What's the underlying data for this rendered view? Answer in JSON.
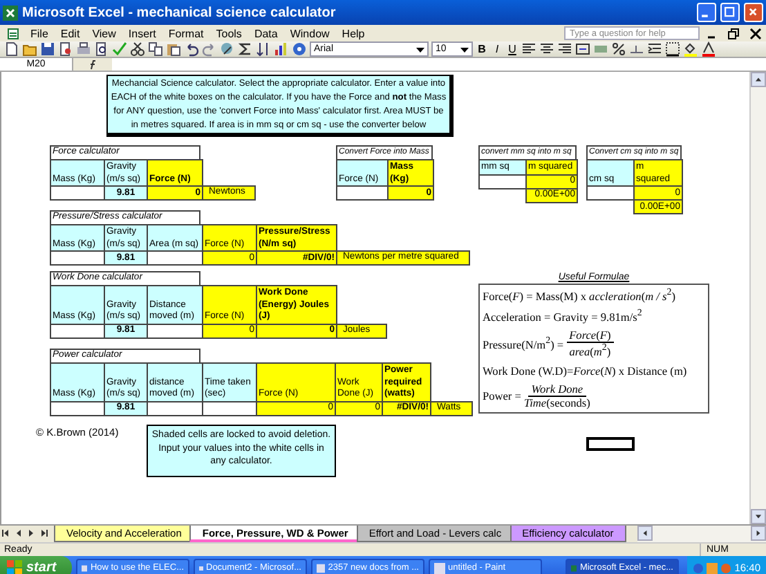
{
  "window": {
    "title": "Microsoft Excel - mechanical science calculator"
  },
  "menu": [
    "File",
    "Edit",
    "View",
    "Insert",
    "Format",
    "Tools",
    "Data",
    "Window",
    "Help"
  ],
  "help_box": {
    "placeholder": "Type a question for help"
  },
  "toolbar": {
    "font": "Arial",
    "size": "10",
    "format_buttons": [
      "B",
      "I",
      "U"
    ]
  },
  "formula_bar": {
    "name_box": "M20"
  },
  "sheet": {
    "note": "Mechancial Science calculator. Select the appropriate calculator. Enter a value into EACH of the white boxes on the calculator. If you have the Force and **not** the Mass for ANY question, use the 'convert Force into Mass' calculator first. Area MUST be in metres squared. If area is in mm sq or cm sq - use the converter below",
    "calculators": [
      {
        "title": "Force calculator",
        "columns": [
          {
            "header": "Mass (Kg)",
            "kind": "input"
          },
          {
            "header": "Gravity (m/s sq)",
            "kind": "constant",
            "value": "9.81"
          },
          {
            "header": "Force (N)",
            "kind": "result",
            "value": "0"
          }
        ],
        "unit": "Newtons"
      },
      {
        "title": "Convert Force into Mass",
        "columns": [
          {
            "header": "Force (N)",
            "kind": "input"
          },
          {
            "header": "Mass (Kg)",
            "kind": "result",
            "value": "0"
          }
        ]
      },
      {
        "title": "convert mm sq into m sq",
        "columns": [
          {
            "header": "mm sq",
            "kind": "input"
          },
          {
            "header": "m squared",
            "kind": "output",
            "value": "0",
            "extra": "0.00E+00"
          }
        ]
      },
      {
        "title": "Convert cm sq into m sq",
        "columns": [
          {
            "header": "cm sq",
            "kind": "input"
          },
          {
            "header": "m squared",
            "kind": "output",
            "value": "0",
            "extra": "0.00E+00"
          }
        ]
      },
      {
        "title": "Pressure/Stress calculator",
        "columns": [
          {
            "header": "Mass (Kg)",
            "kind": "input"
          },
          {
            "header": "Gravity (m/s sq)",
            "kind": "constant",
            "value": "9.81"
          },
          {
            "header": "Area (m sq)",
            "kind": "input"
          },
          {
            "header": "Force (N)",
            "kind": "output",
            "value": "0"
          },
          {
            "header": "Pressure/Stress (N/m sq)",
            "kind": "result",
            "value": "#DIV/0!"
          }
        ],
        "unit": "Newtons per metre squared"
      },
      {
        "title": "Work Done calculator",
        "columns": [
          {
            "header": "Mass (Kg)",
            "kind": "input"
          },
          {
            "header": "Gravity (m/s sq)",
            "kind": "constant",
            "value": "9.81"
          },
          {
            "header": "Distance moved (m)",
            "kind": "input"
          },
          {
            "header": "Force (N)",
            "kind": "output",
            "value": "0"
          },
          {
            "header": "Work Done (Energy) Joules (J)",
            "kind": "result",
            "value": "0"
          }
        ],
        "unit": "Joules"
      },
      {
        "title": "Power calculator",
        "columns": [
          {
            "header": "Mass (Kg)",
            "kind": "input"
          },
          {
            "header": "Gravity (m/s sq)",
            "kind": "constant",
            "value": "9.81"
          },
          {
            "header": "distance moved (m)",
            "kind": "input"
          },
          {
            "header": "Time taken (sec)",
            "kind": "input"
          },
          {
            "header": "Force (N)",
            "kind": "output",
            "value": "0"
          },
          {
            "header": "Work Done (J)",
            "kind": "output",
            "value": "0"
          },
          {
            "header": "Power required (watts)",
            "kind": "result",
            "value": "#DIV/0!"
          }
        ],
        "unit": "Watts"
      }
    ],
    "formulae_title": "Useful Formulae",
    "formulae": [
      {
        "kind": "line",
        "text": "Force(*F*) = Mass(M) x *accleration*(*m / s*$^{2}$)"
      },
      {
        "kind": "line",
        "text": "Acceleration = Gravity = 9.81m/s$^{2}$"
      },
      {
        "kind": "fraction",
        "lhs": "Pressure(N/m$^{2}$) =",
        "numerator": "*Force*(*F*)",
        "denominator": "*area*(*m*$^{2}$)"
      },
      {
        "kind": "line",
        "text": "Work Done (W.D)=*Force*(*N*) x Distance (m)"
      },
      {
        "kind": "fraction",
        "lhs": "Power =",
        "numerator": "*Work Done*",
        "denominator": "*Time*(seconds)"
      }
    ],
    "credit": "© K.Brown (2014)",
    "locked_note": "Shaded cells are locked to avoid deletion. Input your values into the white cells in any calculator."
  },
  "sheet_tabs": [
    {
      "label": "Velocity and Acceleration",
      "selected": false,
      "color": "#ffff99"
    },
    {
      "label": "Force, Pressure, WD & Power",
      "selected": true
    },
    {
      "label": "Effort and Load - Levers calc",
      "selected": false,
      "color": "#c0c0c0"
    },
    {
      "label": "Efficiency calculator",
      "selected": false,
      "color": "#cc99ff"
    }
  ],
  "status_bar": {
    "mode": "Ready",
    "num": "NUM"
  },
  "taskbar": {
    "start": "start",
    "tasks": [
      {
        "label": "How to use the ELEC...",
        "selected": false
      },
      {
        "label": "Document2 - Microsof...",
        "selected": false
      },
      {
        "label": "2357 new docs from ...",
        "selected": false
      },
      {
        "label": "untitled - Paint",
        "selected": false
      },
      {
        "label": "Microsoft Excel - mec...",
        "selected": true
      }
    ],
    "clock": "16:40"
  }
}
